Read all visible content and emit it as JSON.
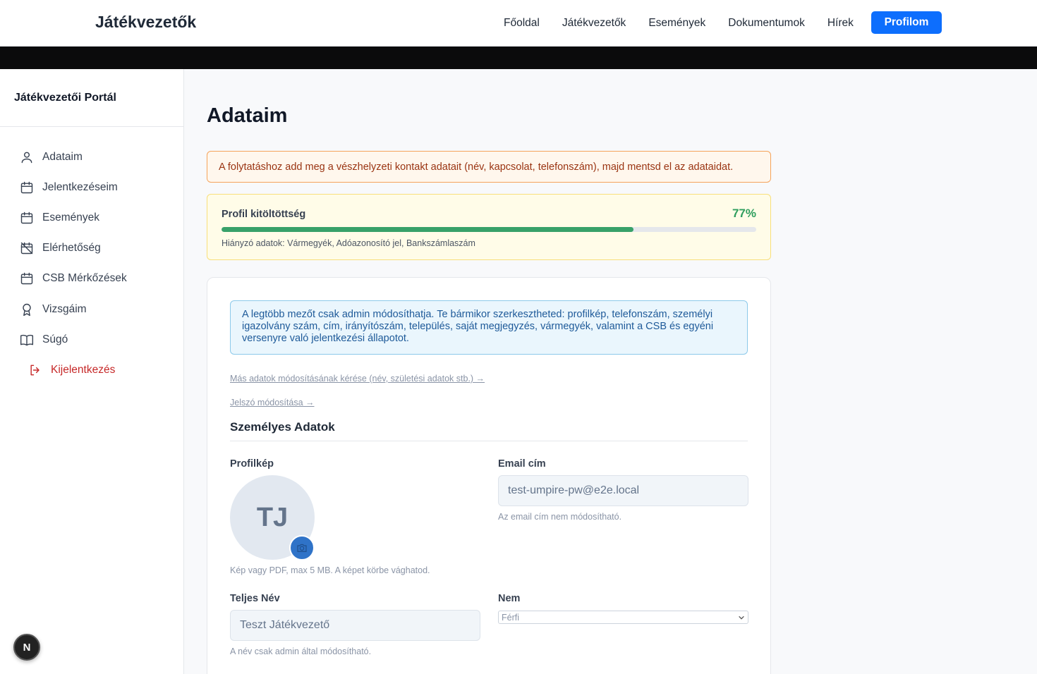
{
  "header": {
    "brand": "Játékvezetők",
    "nav": [
      "Főoldal",
      "Játékvezetők",
      "Események",
      "Dokumentumok",
      "Hírek"
    ],
    "profile_button": "Profilom"
  },
  "sidebar": {
    "title": "Játékvezetői Portál",
    "items": [
      {
        "label": "Adataim",
        "icon": "user-icon"
      },
      {
        "label": "Jelentkezéseim",
        "icon": "calendar-icon"
      },
      {
        "label": "Események",
        "icon": "calendar-icon"
      },
      {
        "label": "Elérhetőség",
        "icon": "calendar-off-icon"
      },
      {
        "label": "CSB Mérkőzések",
        "icon": "calendar-icon"
      },
      {
        "label": "Vizsgáim",
        "icon": "award-icon"
      },
      {
        "label": "Súgó",
        "icon": "book-icon"
      }
    ],
    "logout": "Kijelentkezés"
  },
  "main": {
    "title": "Adataim",
    "warning": "A folytatáshoz add meg a vészhelyzeti kontakt adatait (név, kapcsolat, telefonszám), majd mentsd el az adataidat.",
    "progress": {
      "label": "Profil kitöltöttség",
      "percent_text": "77%",
      "value": 0.77,
      "missing": "Hiányzó adatok: Vármegyék, Adóazonosító jel, Bankszámlaszám"
    },
    "info": "A legtöbb mezőt csak admin módosíthatja. Te bármikor szerkesztheted: profilkép, telefonszám, személyi igazolvány szám, cím, irányítószám, település, saját megjegyzés, vármegyék, valamint a CSB és egyéni versenyre való jelentkezési állapotot.",
    "link_other": "Más adatok módosításának kérése (név, születési adatok stb.) →",
    "link_password": "Jelszó módosítása →",
    "section_title": "Személyes Adatok",
    "profile_pic_label": "Profilkép",
    "avatar_initials": "TJ",
    "profile_pic_hint": "Kép vagy PDF, max 5 MB. A képet körbe vághatod.",
    "email_label": "Email cím",
    "email_value": "test-umpire-pw@e2e.local",
    "email_hint": "Az email cím nem módosítható.",
    "name_label": "Teljes Név",
    "name_value": "Teszt Játékvezető",
    "name_hint": "A név csak admin által módosítható.",
    "gender_label": "Nem",
    "gender_value": "Férfi"
  },
  "dev_badge": "N",
  "colors": {
    "primary": "#0d6efd",
    "progress": "#38a169",
    "logout": "#c62828"
  }
}
